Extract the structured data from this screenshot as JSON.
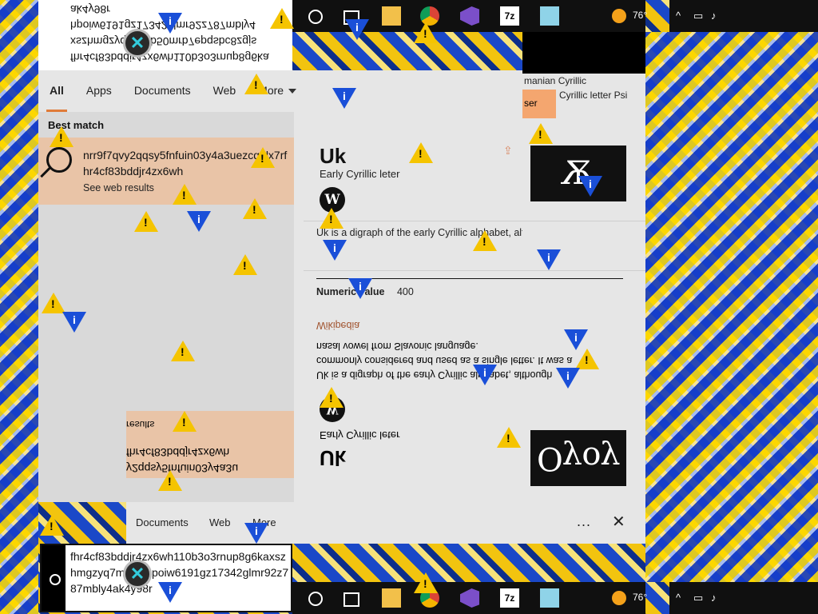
{
  "search_query": "fhr4cf83bddjr4zx6wh110b3o3rnup8g6kaxszhmgzyq7mbly4hpoiw6191gz17342glmr92z787mbly4ak4y98r",
  "search_box_lines": [
    "fhr4cf83bddjr4zx6wh110b3o3rnup8g6ka",
    "xszhmgzyq711ob50mrb7epqsbc8zgjs",
    "hpoiw6191gz17342glmr92z787mbly4",
    "ak4y98r"
  ],
  "tabs": [
    "All",
    "Apps",
    "Documents",
    "Web",
    "More"
  ],
  "best_match": {
    "label": "Best match",
    "title": "nrr9f7qvy2qqsy5fnfuin03y4a3uezcq3lx7rfhr4cf83bddjr4zx6wh",
    "subtitle": "See web results"
  },
  "entity": {
    "title": "Uk",
    "subtitle": "Early Cyrillic leter",
    "thumb_glyph": "Ѫ",
    "description": "Uk is a digraph of the early Cyrillic alphabet, although commonly considered and used as a single letter. It was a nasal vowel from Slavonic language.",
    "numeric_label": "Numeric value",
    "numeric_value": "400",
    "source_link": "Wikipedia",
    "wiki_glyph": "W"
  },
  "top_peek": {
    "line1": "manian Cyrillic",
    "line2": "Cyrillic letter Psi",
    "chip": "ser"
  },
  "ghost": {
    "card_line1": "y2qqsy5fnfuin03y4a3u",
    "card_line2": "fhr4cf83bddjr4zx6wh",
    "card_line3": "results",
    "title": "Uk",
    "subtitle": "Early Cyrillic leter",
    "thumb_glyph": "Оуоу"
  },
  "bottom_bar": {
    "tabs": [
      "Documents",
      "Web",
      "More"
    ],
    "dots": "...",
    "close": "✕"
  },
  "taskbar": {
    "temp": "76°",
    "sevenzip": "7z"
  },
  "colors": {
    "accent": "#e07b39",
    "best_match_bg": "#e9c4a7",
    "panel_bg": "#e6e6e6",
    "warning": "#f5c400",
    "info": "#1a4fd8"
  }
}
